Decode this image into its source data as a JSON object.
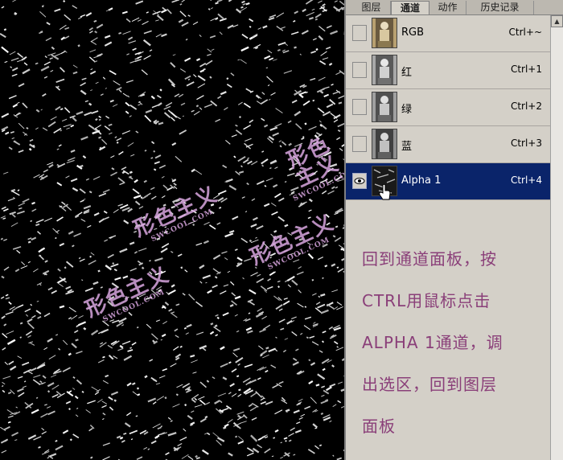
{
  "tabs": [
    {
      "label": "图层",
      "active": false
    },
    {
      "label": "通道",
      "active": true
    },
    {
      "label": "动作",
      "active": false
    },
    {
      "label": "历史记录",
      "active": false
    }
  ],
  "channels": [
    {
      "name": "RGB",
      "shortcut": "Ctrl+~",
      "visible": false,
      "selected": false
    },
    {
      "name": "红",
      "shortcut": "Ctrl+1",
      "visible": false,
      "selected": false
    },
    {
      "name": "绿",
      "shortcut": "Ctrl+2",
      "visible": false,
      "selected": false
    },
    {
      "name": "蓝",
      "shortcut": "Ctrl+3",
      "visible": false,
      "selected": false
    },
    {
      "name": "Alpha 1",
      "shortcut": "Ctrl+4",
      "visible": true,
      "selected": true
    }
  ],
  "watermark": {
    "main": "形色主义",
    "sub": "SWCOOL.COM"
  },
  "instruction_lines": [
    "回到通道面板，按",
    "CTRL用鼠标点击",
    "ALPHA 1通道，调",
    "出选区，回到图层",
    "面板"
  ],
  "colors": {
    "selected_row": "#0a246a",
    "instruction_text": "#8a3f79",
    "watermark": "#d9a6e0"
  }
}
